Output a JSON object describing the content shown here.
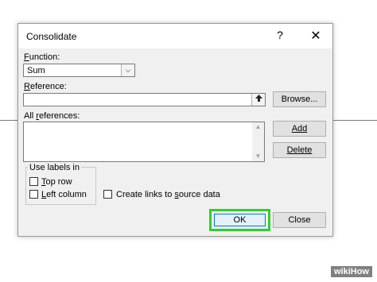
{
  "dialog": {
    "title": "Consolidate",
    "help_glyph": "?",
    "close_glyph": "✕"
  },
  "function": {
    "label_mnemonic": "F",
    "label_rest": "unction:",
    "selected": "Sum"
  },
  "reference": {
    "label_mnemonic": "R",
    "label_rest": "eference:",
    "value": "",
    "browse_label": "Browse..."
  },
  "all_references": {
    "label_pre": "All ",
    "label_mnemonic": "r",
    "label_rest": "eferences:",
    "items": [],
    "add_label": "Add",
    "delete_label": "Delete"
  },
  "use_labels": {
    "title": "Use labels in",
    "top_row_mnemonic": "T",
    "top_row_rest": "op row",
    "left_column_mnemonic": "L",
    "left_column_rest": "eft column",
    "top_row_checked": false,
    "left_column_checked": false
  },
  "links": {
    "label_pre": "Create links to ",
    "label_mnemonic": "s",
    "label_rest": "ource data",
    "checked": false
  },
  "footer": {
    "ok_label": "OK",
    "close_label": "Close"
  },
  "watermark": "wikiHow",
  "colors": {
    "highlight": "#2ed02e",
    "focus_border": "#0078d7"
  }
}
